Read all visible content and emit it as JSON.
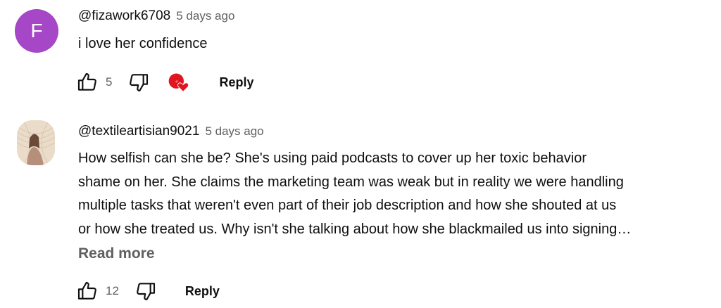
{
  "comments": [
    {
      "avatar_letter": "F",
      "avatar_color": "#a547c6",
      "author": "@fizawork6708",
      "time": "5 days ago",
      "lines": [
        "i love her confidence"
      ],
      "like_count": "5",
      "reply_label": "Reply",
      "has_creator_heart": true
    },
    {
      "avatar_type": "photo",
      "author": "@textileartisian9021",
      "time": "5 days ago",
      "lines": [
        "How selfish can she be? She's using paid podcasts to cover up her toxic behavior",
        "shame on her. She claims the marketing team was weak but in reality we were handling",
        "multiple tasks that weren't even part of their job description and how she shouted at us",
        "or how she treated us. Why isn't she talking about how she blackmailed us into signing…"
      ],
      "read_more_label": "Read more",
      "like_count": "12",
      "reply_label": "Reply",
      "has_creator_heart": false
    }
  ],
  "icons": {
    "like": "thumbs-up-icon",
    "dislike": "thumbs-down-icon",
    "creator_heart": "creator-heart-icon"
  },
  "colors": {
    "text_primary": "#0f0f0f",
    "text_secondary": "#606060",
    "heart_red": "#e1151f"
  }
}
